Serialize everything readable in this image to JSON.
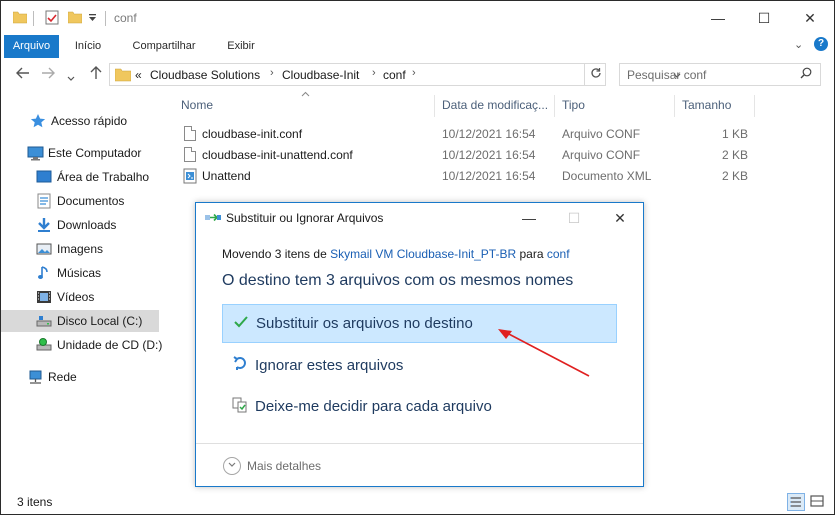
{
  "window": {
    "title": "conf",
    "minimize_glyph": "—",
    "maximize_glyph": "☐",
    "close_glyph": "✕"
  },
  "ribbon": {
    "tabs": [
      "Arquivo",
      "Início",
      "Compartilhar",
      "Exibir"
    ],
    "active_tab": "Arquivo",
    "collapse_glyph": "⌄",
    "help_glyph": "?"
  },
  "address": {
    "overflow": "«",
    "breadcrumbs": [
      "Cloudbase Solutions",
      "Cloudbase-Init",
      "conf"
    ],
    "search_placeholder": "Pesquisar conf"
  },
  "nav": {
    "items": [
      {
        "label": "Acesso rápido",
        "icon": "star-icon"
      },
      {
        "label": "Este Computador",
        "icon": "computer-icon"
      },
      {
        "label": "Área de Trabalho",
        "icon": "desktop-icon"
      },
      {
        "label": "Documentos",
        "icon": "documents-icon"
      },
      {
        "label": "Downloads",
        "icon": "download-icon"
      },
      {
        "label": "Imagens",
        "icon": "pictures-icon"
      },
      {
        "label": "Músicas",
        "icon": "music-icon"
      },
      {
        "label": "Vídeos",
        "icon": "videos-icon"
      },
      {
        "label": "Disco Local (C:)",
        "icon": "drive-icon"
      },
      {
        "label": "Unidade de CD (D:)",
        "icon": "cd-drive-icon"
      },
      {
        "label": "Rede",
        "icon": "network-icon"
      }
    ],
    "selected": "Disco Local (C:)"
  },
  "files": {
    "columns": [
      "Nome",
      "Data de modificaç...",
      "Tipo",
      "Tamanho"
    ],
    "rows": [
      {
        "name": "cloudbase-init.conf",
        "date": "10/12/2021 16:54",
        "type": "Arquivo CONF",
        "size": "1 KB"
      },
      {
        "name": "cloudbase-init-unattend.conf",
        "date": "10/12/2021 16:54",
        "type": "Arquivo CONF",
        "size": "2 KB"
      },
      {
        "name": "Unattend",
        "date": "10/12/2021 16:54",
        "type": "Documento XML",
        "size": "2 KB"
      }
    ]
  },
  "status": {
    "item_count": "3 itens"
  },
  "dialog": {
    "title": "Substituir ou Ignorar Arquivos",
    "moving_prefix": "Movendo 3 itens de ",
    "source": "Skymail VM Cloudbase-Init_PT-BR",
    "moving_middle": " para ",
    "destination": "conf",
    "heading": "O destino tem 3 arquivos com os mesmos nomes",
    "options": [
      {
        "label": "Substituir os arquivos no destino",
        "icon": "checkmark-icon",
        "highlighted": true
      },
      {
        "label": "Ignorar estes arquivos",
        "icon": "skip-arrow-icon",
        "highlighted": false
      },
      {
        "label": "Deixe-me decidir para cada arquivo",
        "icon": "compare-files-icon",
        "highlighted": false
      }
    ],
    "more_details": "Mais detalhes",
    "colors": {
      "accent": "#1979ca",
      "highlight": "#cce8ff",
      "annotation_arrow": "#e02020"
    }
  }
}
